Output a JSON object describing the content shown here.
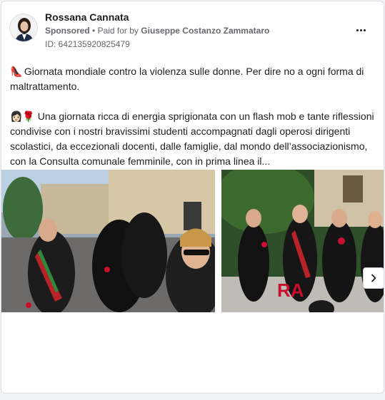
{
  "post": {
    "author_name": "Rossana Cannata",
    "sponsored_label": "Sponsored",
    "separator": "•",
    "paid_for_prefix": "Paid for by",
    "paid_for_name": "Giuseppe Costanzo Zammataro",
    "ad_id": "ID: 642135920825479",
    "more_icon": "more-horizontal-icon"
  },
  "content": {
    "paragraph1_emoji": "👠",
    "paragraph1": "Giornata mondiale contro la violenza sulle donne. Per dire no a ogni forma di maltrattamento.",
    "paragraph2_emoji": "👩🏻🌹",
    "paragraph2": "Una giornata ricca di energia sprigionata con un flash mob e tante riflessioni condivise con i nostri bravissimi studenti accompagnati dagli operosi dirigenti scolastici, da eccezionali docenti, dalle famiglie, dal mondo dell’associazionismo, con la Consulta comunale femminile, con in prima linea il..."
  },
  "carousel": {
    "next_icon": "chevron-right-icon",
    "slides": [
      {
        "description_icon": "photo-flash-mob-square"
      },
      {
        "description_icon": "photo-speakers-garden"
      }
    ]
  },
  "colors": {
    "text_primary": "#1c1e21",
    "text_secondary": "#65676b",
    "card_border": "#dddfe2",
    "page_bg": "#f0f2f5"
  }
}
